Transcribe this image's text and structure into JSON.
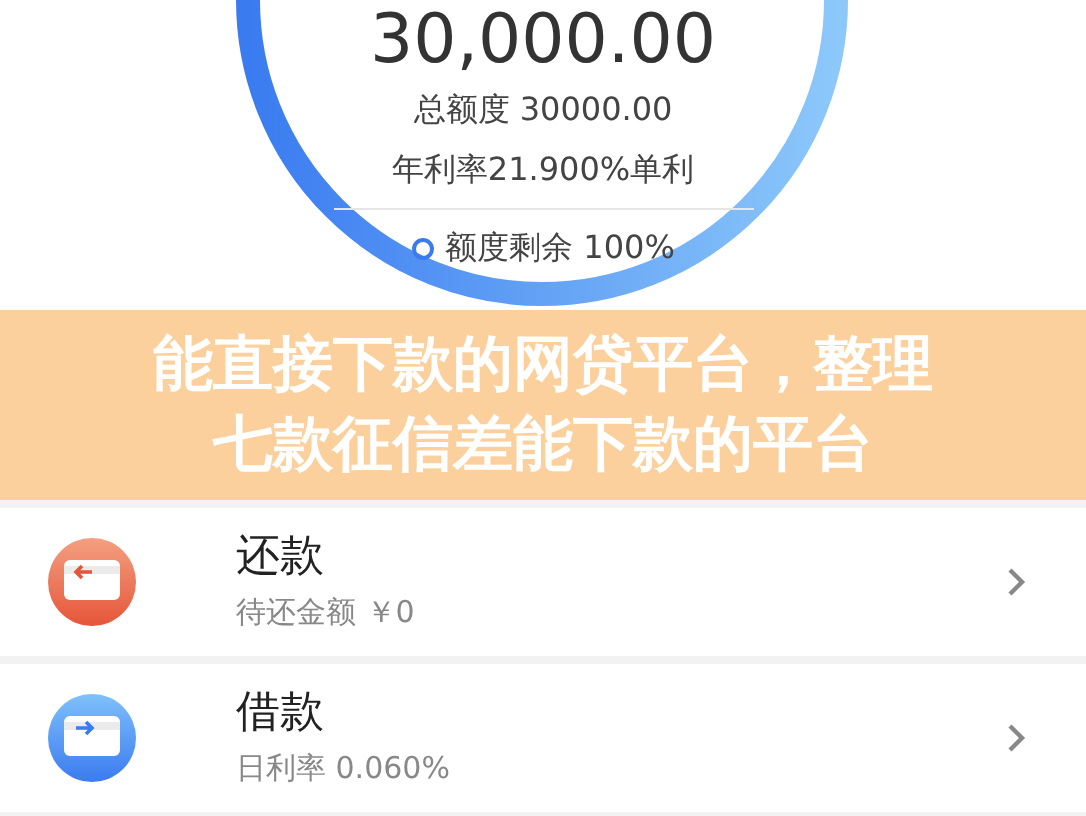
{
  "credit": {
    "amount": "30,000.00",
    "total": "总额度 30000.00",
    "rate": "年利率21.900%单利",
    "remaining": "额度剩余 100%"
  },
  "banner": {
    "lines": [
      "能直接下款的网贷平台，整理",
      "七款征信差能下款的平台"
    ]
  },
  "actions": [
    {
      "kind": "repay",
      "title": "还款",
      "subtitle": "待还金额 ￥0"
    },
    {
      "kind": "borrow",
      "title": "借款",
      "subtitle": "日利率 0.060%"
    }
  ]
}
